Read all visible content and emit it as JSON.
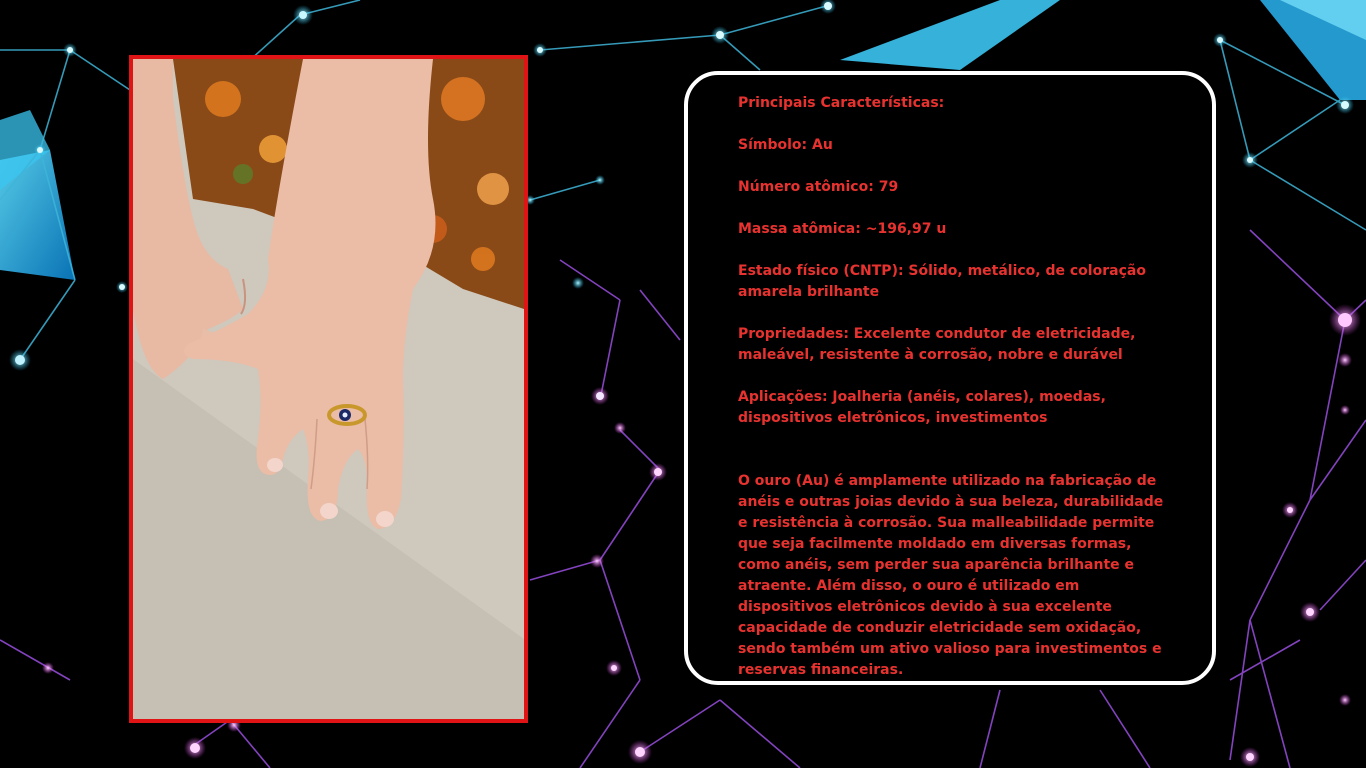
{
  "photo": {
    "description_icon": "hands-with-gold-rings-photo"
  },
  "info": {
    "heading": "Principais Características:",
    "symbol": "Símbolo: Au",
    "atomic_number": "Número atômico: 79",
    "atomic_mass": "Massa atômica: ~196,97 u",
    "physical_state": "Estado físico (CNTP): Sólido, metálico, de coloração amarela brilhante",
    "properties": "Propriedades: Excelente condutor de eletricidade, maleável, resistente à corrosão, nobre e durável",
    "applications": "Aplicações: Joalheria (anéis, colares), moedas, dispositivos eletrônicos, investimentos",
    "paragraph": "O ouro (Au) é amplamente utilizado na fabricação de anéis e outras joias devido à sua beleza, durabilidade e resistência à corrosão. Sua malleabilidade permite que seja facilmente moldado em diversas formas, como anéis, sem perder sua aparência brilhante e atraente. Além disso, o ouro é utilizado em dispositivos eletrônicos devido à sua excelente capacidade de conduzir eletricidade sem oxidação, sendo também um ativo valioso para investimentos e reservas financeiras."
  },
  "colors": {
    "text_red": "#e8322f",
    "frame_red": "#e01414",
    "card_border": "#ffffff",
    "background": "#000000"
  }
}
